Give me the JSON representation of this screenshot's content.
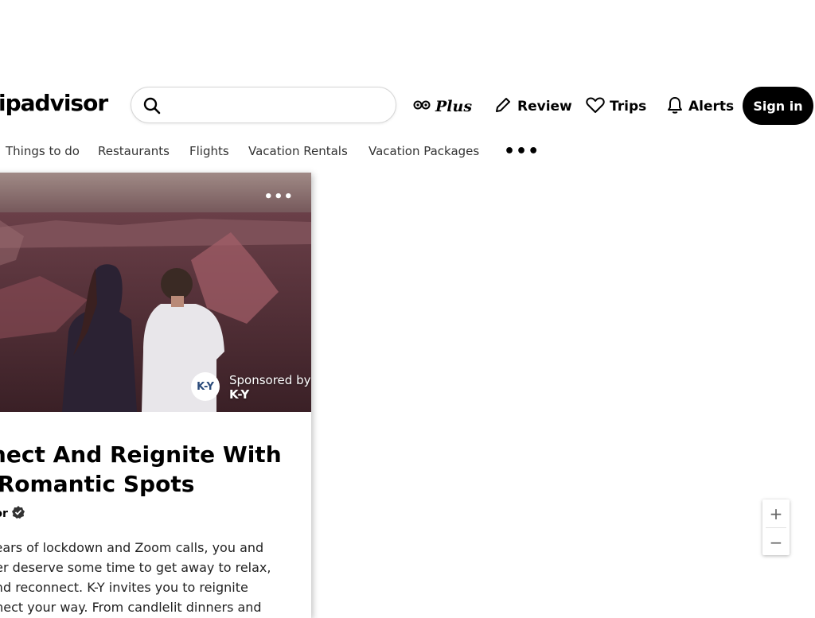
{
  "header": {
    "logo_text": "ipadvisor",
    "search": {
      "value": "",
      "placeholder": ""
    },
    "plus_label": "Plus",
    "review_label": "Review",
    "trips_label": "Trips",
    "alerts_label": "Alerts",
    "signin_label": "Sign in",
    "icons": [
      "search-icon",
      "owl-eyes-icon",
      "pencil-icon",
      "heart-icon",
      "bell-icon",
      "more-icon"
    ]
  },
  "nav": {
    "items": [
      "Things to do",
      "Restaurants",
      "Flights",
      "Vacation Rentals",
      "Vacation Packages"
    ],
    "more_label": "•••"
  },
  "card": {
    "more_label": "•••",
    "sponsor_logo_text": "K-Y",
    "sponsored_by": "Sponsored by",
    "sponsor_name": "K-Y",
    "title_line1": "nnect And Reignite With",
    "title_line2": "e Romantic Spots",
    "author": "sor",
    "body_lines": [
      "years of lockdown and Zoom calls, you and",
      "her deserve some time to get away to relax,",
      "and reconnect. K-Y invites you to reignite",
      "nnect your way. From candlelit dinners and"
    ]
  },
  "zoom": {
    "in_label": "+",
    "out_label": "−"
  }
}
